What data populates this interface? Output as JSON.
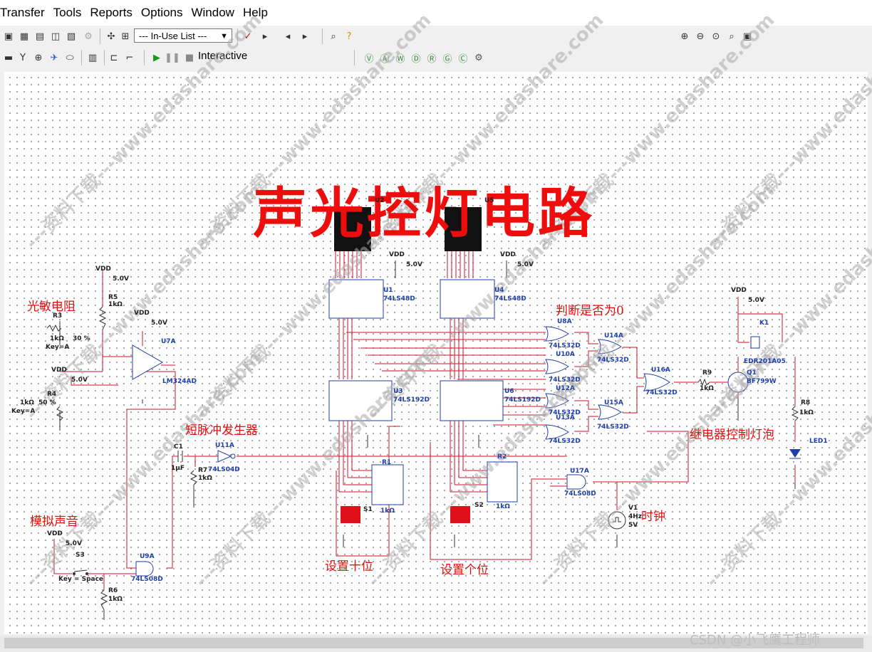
{
  "menu": [
    "Transfer",
    "Tools",
    "Reports",
    "Options",
    "Window",
    "Help"
  ],
  "toolbar": {
    "in_use_list": "--- In-Use List ---",
    "interactive_label": "Interactive"
  },
  "schematic": {
    "title": "声光控灯电路",
    "notes": {
      "photoresistor": "光敏电阻",
      "simulated_sound": "模拟声音",
      "short_pulse": "短脉冲发生器",
      "judge_zero": "判断是否为0",
      "relay_lamp": "继电器控制灯泡",
      "clock": "时钟",
      "set_tens": "设置十位",
      "set_ones": "设置个位"
    },
    "components": {
      "vdd": "VDD",
      "v5": "5.0V",
      "r5": "R5",
      "r5_val": "1kΩ",
      "r3": "R3",
      "r3_val": "1kΩ",
      "r3_pct": "30 %",
      "key_a": "Key=A",
      "r4": "R4",
      "r4_val": "1kΩ",
      "r4_pct": "50 %",
      "u7a": "U7A",
      "lm324ad": "LM324AD",
      "c1": "C1",
      "c1_val": "1µF",
      "r7": "R7",
      "r7_val": "1kΩ",
      "u11a": "U11A",
      "ls04d": "74LS04D",
      "s3": "S3",
      "key_space": "Key = Space",
      "u9a": "U9A",
      "ls08d": "74LS08D",
      "r6": "R6",
      "r6_val": "1kΩ",
      "u2": "U2",
      "u5": "U5",
      "u1": "U1",
      "u4": "U4",
      "ls48d": "74LS48D",
      "u3": "U3",
      "u6": "U6",
      "ls192d": "74LS192D",
      "r1": "R1",
      "r1_val": "1kΩ",
      "r2": "R2",
      "r2_val": "1kΩ",
      "s1": "S1",
      "s2": "S2",
      "u8a": "U8A",
      "u10a": "U10A",
      "u12a": "U12A",
      "u13a": "U13A",
      "u14a": "U14A",
      "u15a": "U15A",
      "u16a": "U16A",
      "ls32d": "74LS32D",
      "u17a": "U17A",
      "v1": "V1",
      "v1_f": "4Hz",
      "v1_a": "5V",
      "r9": "R9",
      "r9_val": "1kΩ",
      "q1": "Q1",
      "q1_type": "BF799W",
      "k1": "K1",
      "k1_type": "EDR201A05",
      "r8": "R8",
      "r8_val": "1kΩ",
      "led1": "LED1"
    }
  },
  "watermark": "---资料下载---www.edashare.com",
  "credit": "CSDN @小飞鹰工程师"
}
